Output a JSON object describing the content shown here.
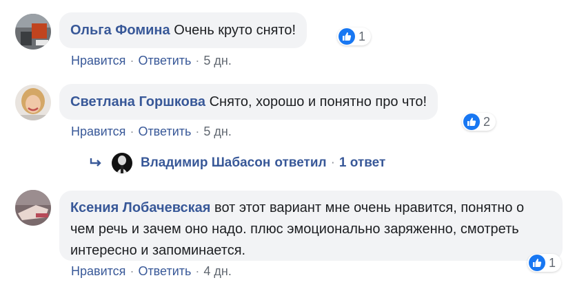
{
  "comments": [
    {
      "author": "Ольга Фомина",
      "text": "Очень круто снято!",
      "like_label": "Нравится",
      "reply_label": "Ответить",
      "time": "5 дн.",
      "likes": "1"
    },
    {
      "author": "Светлана Горшкова",
      "text": "Снято, хорошо и понятно про что!",
      "like_label": "Нравится",
      "reply_label": "Ответить",
      "time": "5 дн.",
      "likes": "2"
    },
    {
      "author": "Ксения Лобачевская",
      "text": "вот этот вариант мне очень нравится, понятно о чем речь и зачем оно надо. плюс эмоционально заряженно, смотреть интересно и запоминается.",
      "like_label": "Нравится",
      "reply_label": "Ответить",
      "time": "4 дн.",
      "likes": "1"
    }
  ],
  "reply_summary": {
    "name": "Владимир Шабасон",
    "verb": "ответил",
    "count": "1 ответ"
  },
  "colors": {
    "link": "#385898",
    "bubble": "#f2f3f5",
    "like_blue": "#1877f2",
    "meta": "#606770"
  }
}
